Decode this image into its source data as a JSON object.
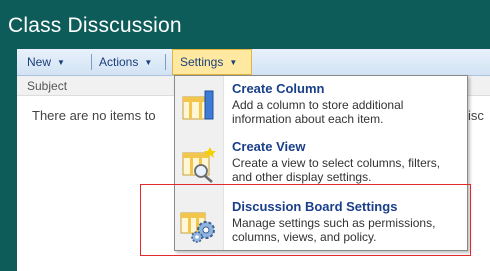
{
  "page": {
    "title": "Class Disscussion"
  },
  "toolbar": {
    "new_label": "New",
    "actions_label": "Actions",
    "settings_label": "Settings"
  },
  "list": {
    "column_subject": "Subject",
    "empty_message": "There are no items to",
    "overflow_text": "isc"
  },
  "settings_menu": {
    "items": [
      {
        "title": "Create Column",
        "description": "Add a column to store additional information about each item.",
        "icon": "create-column-icon"
      },
      {
        "title": "Create View",
        "description": "Create a view to select columns, filters, and other display settings.",
        "icon": "create-view-icon"
      },
      {
        "title": "Discussion Board Settings",
        "description": "Manage settings such as permissions, columns, views, and policy.",
        "icon": "board-settings-icon"
      }
    ]
  },
  "colors": {
    "background": "#0e5c5a",
    "accent": "#1a3f8a",
    "settings_highlight": "#ffe9a0",
    "annotation_box": "#e32a2a"
  }
}
